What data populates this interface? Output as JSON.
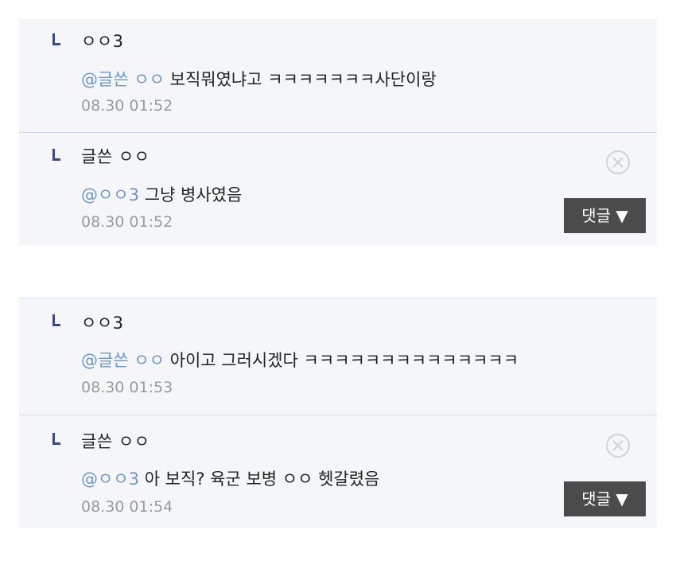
{
  "thread_1": {
    "comments": [
      {
        "author": "ㅇㅇ3",
        "mention": "@글쓴 ㅇㅇ",
        "text": " 보직뭐였냐고 ㅋㅋㅋㅋㅋㅋㅋ사단이랑",
        "time": "08.30 01:52"
      },
      {
        "author": "글쓴 ㅇㅇ",
        "mention": "@ㅇㅇ3",
        "text": " 그냥 병사였음",
        "time": "08.30 01:52",
        "reply_label": "댓글 ▼"
      }
    ]
  },
  "thread_2": {
    "comments": [
      {
        "author": "ㅇㅇ3",
        "mention": "@글쓴 ㅇㅇ",
        "text": " 아이고 그러시겠다 ㅋㅋㅋㅋㅋㅋㅋㅋㅋㅋㅋㅋㅋㅋ",
        "time": "08.30 01:53"
      },
      {
        "author": "글쓴 ㅇㅇ",
        "mention": "@ㅇㅇ3",
        "text": " 아 보직? 육군 보병 ㅇㅇ 헷갈렸음",
        "time": "08.30 01:54",
        "reply_label": "댓글 ▼"
      }
    ]
  },
  "colors": {
    "accent_mark": "#3b4790",
    "mention": "#6f97c7",
    "timestamp": "#9a9a9a",
    "panel_bg": "#f5f6fa",
    "button_bg": "#4b4b4b"
  },
  "icons": {
    "reply_marker": "reply-arrow-icon",
    "delete": "close-circle-icon"
  }
}
